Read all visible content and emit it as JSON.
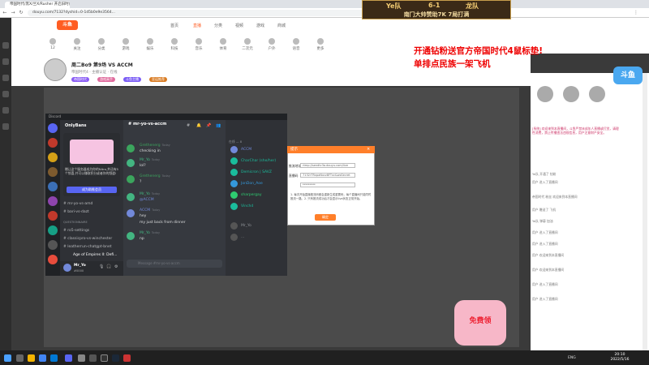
{
  "browser": {
    "tab_title": "帝国时代/黑X/兰X/Rusher 开启旧时代",
    "url": "douyu.com/7132?dyshid=0-1d5b0e9e3564..."
  },
  "site": {
    "logo": "斗鱼",
    "nav": [
      "首页",
      "直播",
      "分类",
      "视频",
      "游戏",
      "商城"
    ],
    "categories": [
      "12",
      "关注",
      "分类",
      "游戏",
      "娱乐",
      "科技",
      "音乐",
      "体育",
      "二次元",
      "户外",
      "语音",
      "更多"
    ]
  },
  "room": {
    "title": "周二Bo9 第9场 VS ACCM",
    "subtitle": "帝国时代4 · 主播认证 · 在线",
    "tags": [
      "帝国时代",
      "游戏高手",
      "斗鱼主播",
      "亚运推荐"
    ]
  },
  "promo": [
    "开通钻粉送官方帝国时代4鼠标垫!",
    "单排点民族一架飞机"
  ],
  "banner": {
    "left_team": "Ye队",
    "score": "6-1",
    "right_team": "龙队",
    "bottom_text": "南门大帅赞助7K  7局打满"
  },
  "discord": {
    "title": "Discord",
    "server_name": "OnlyBans",
    "nitro_text": "赠让这个服务器成为你的Nitro,并还有5个惊喜,并可以赚取积分或者你的频道!",
    "nitro_button": "成为助推会员",
    "channels": [
      {
        "type": "chan",
        "name": "mr-yo-vs-amd"
      },
      {
        "type": "chan",
        "name": "bari-vs-dazt"
      },
      {
        "type": "cat",
        "name": "QUESTIONNAIRE"
      },
      {
        "type": "chan",
        "name": "ro5-settings"
      },
      {
        "type": "chan",
        "name": "classicpro-vs-winchester"
      },
      {
        "type": "chan",
        "name": "leatherrun-chatgpt-bnet"
      }
    ],
    "now_playing": "Age of Empires II: Defi...",
    "user": {
      "name": "Mr_Yo",
      "tag": "#0000"
    },
    "chat_channel": "mr-yo-vs-accm",
    "messages": [
      {
        "name": "Grethenerg",
        "time": "Today",
        "text": "checking in",
        "color": "#3ba55d"
      },
      {
        "name": "Mr_Yo",
        "time": "Today",
        "text": "lol?",
        "color": "#43b581"
      },
      {
        "name": "Grethenerg",
        "time": "Today",
        "text": "?",
        "color": "#3ba55d"
      },
      {
        "name": "Mr_Yo",
        "time": "Today",
        "text": "@ACCM",
        "color": "#43b581"
      },
      {
        "name": "ACCM",
        "time": "Today",
        "text": "hey",
        "color": "#7289da"
      },
      {
        "name": "",
        "time": "",
        "text": "my just back from dinner",
        "color": "#dcddde"
      },
      {
        "name": "Mr_Yo",
        "time": "Today",
        "text": "np",
        "color": "#43b581"
      }
    ],
    "chat_input_placeholder": "Message #mr-yo-vs-accm",
    "members_header": "在线 — 8",
    "members": [
      {
        "name": "ACCM",
        "color": "#7289da"
      },
      {
        "name": "CharChar (she/her)",
        "color": "#1abc9c"
      },
      {
        "name": "Demicron | SAVZ",
        "color": "#1abc9c"
      },
      {
        "name": "JonDon_Aoe",
        "color": "#3498db"
      },
      {
        "name": "sharpergay",
        "color": "#2ecc71"
      },
      {
        "name": "Vinchd",
        "color": "#1abc9c"
      },
      {
        "name": "Mr_Yo",
        "color": "#8e9297"
      },
      {
        "name": "...",
        "color": "#8e9297"
      }
    ]
  },
  "dialog": {
    "title": "提示",
    "row1_label": "推流地址",
    "row1_value": "rtmp://sendtc3a.douyu.com/live",
    "row2_label": "直播码",
    "row2_value": "7132rTRxpaNxcz8FTxc&wsSecret",
    "row3_value": "*********",
    "note": "1. 每次开始直播推流码都会重新生成重置码，每个直播间只能同时推流一路。2. 只有推流成功后才会显示live状态正常开始。",
    "ok": "确定"
  },
  "gift": "免费领",
  "right": {
    "logo": "斗鱼",
    "notice": "[系统] 欢迎来到本直播间，斗鱼严禁未成年人直播或打赏，请理性消费，禁止传播违法违规信息，用户注意财产安全。",
    "chat": [
      "Ye队 开通了 钻粉",
      "用户 进入了直播间",
      "帝国时代 粉丝 欢迎来到本直播间",
      "用户 赠送了 飞机",
      "Ye队 弹幕 加油",
      "用户 进入了直播间",
      "用户 进入了直播间",
      "用户 欢迎来到本直播间",
      "用户 欢迎来到本直播间",
      "用户 进入了直播间",
      "用户 进入了直播间"
    ]
  },
  "taskbar": {
    "tray": "ENG",
    "time": "20:10",
    "date": "2022/5/16"
  }
}
